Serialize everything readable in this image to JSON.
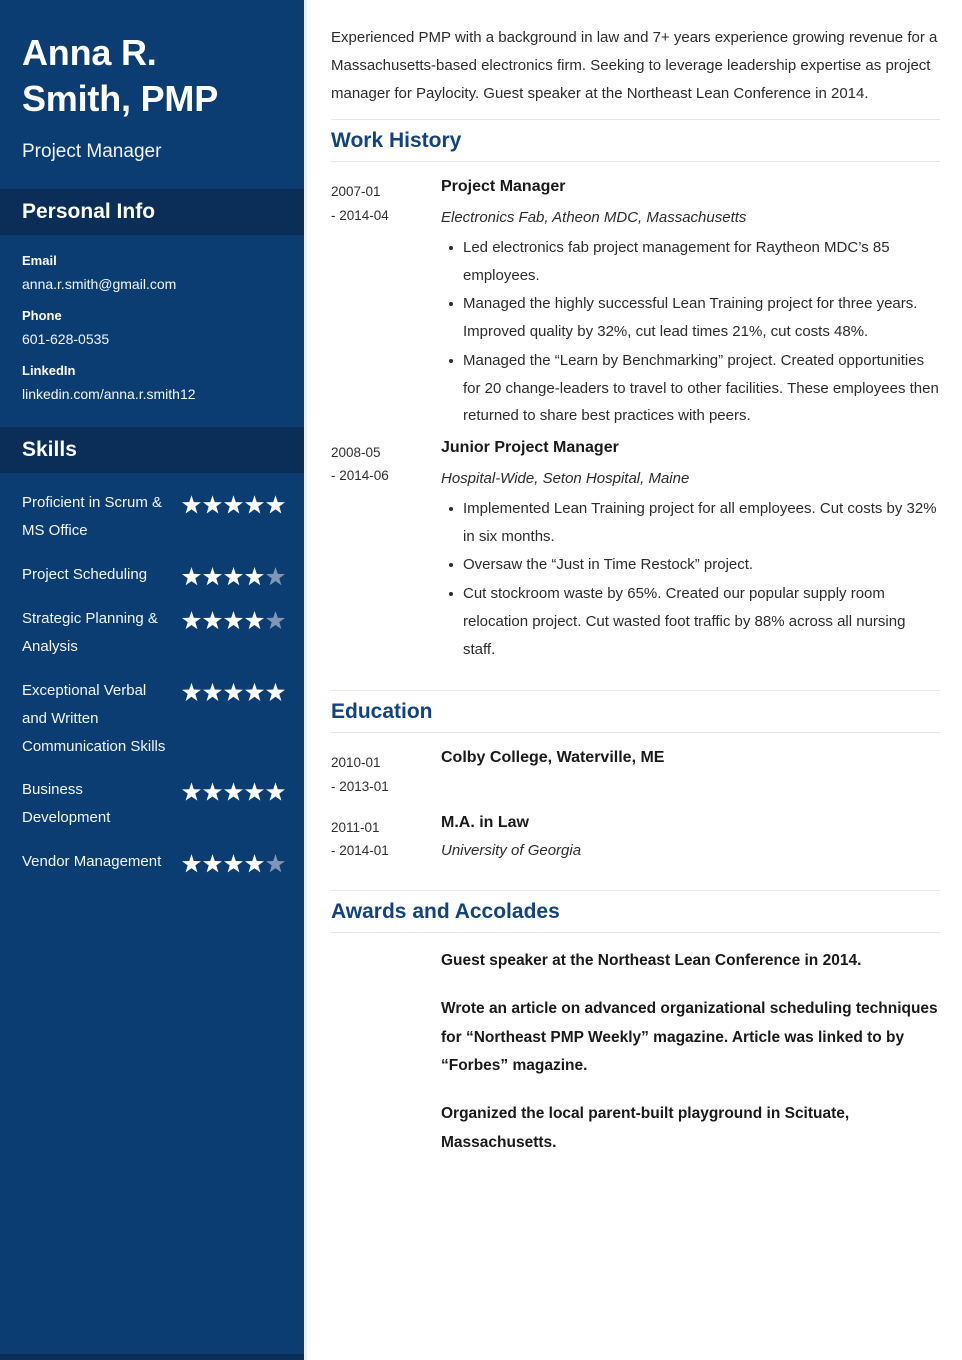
{
  "sidebar": {
    "name": "Anna R. Smith, PMP",
    "name_line1": "Anna R.",
    "name_line2": "Smith, PMP",
    "job_title": "Project Manager",
    "personal_info": {
      "heading": "Personal Info",
      "items": [
        {
          "label": "Email",
          "value": "anna.r.smith@gmail.com"
        },
        {
          "label": "Phone",
          "value": "601-628-0535"
        },
        {
          "label": "LinkedIn",
          "value": "linkedin.com/anna.r.smith12"
        }
      ]
    },
    "skills": {
      "heading": "Skills",
      "max_rating": 5,
      "items": [
        {
          "name": "Proficient in Scrum & MS Office",
          "rating": 5
        },
        {
          "name": "Project Scheduling",
          "rating": 4
        },
        {
          "name": "Strategic Planning & Analysis",
          "rating": 4
        },
        {
          "name": "Exceptional Verbal and Written Communication Skills",
          "rating": 5
        },
        {
          "name": "Business Development",
          "rating": 5
        },
        {
          "name": "Vendor Management",
          "rating": 4
        }
      ]
    }
  },
  "main": {
    "summary": "Experienced PMP with a background in law and 7+ years experience growing revenue for a Massachusetts-based electronics firm. Seeking to leverage leadership expertise as project manager for Paylocity. Guest speaker at the Northeast Lean Conference in 2014.",
    "work_history": {
      "heading": "Work History",
      "entries": [
        {
          "date_start": "2007-01",
          "date_end": "- 2014-04",
          "role": "Project Manager",
          "org": "Electronics Fab, Atheon MDC, Massachusetts",
          "bullets": [
            "Led electronics fab project management for Raytheon MDC’s 85 employees.",
            "Managed the highly successful Lean Training project for three years. Improved quality by 32%, cut lead times 21%, cut costs 48%.",
            "Managed the “Learn by Benchmarking” project. Created opportunities for 20 change-leaders to travel to other facilities. These employees then returned to share best practices with peers."
          ]
        },
        {
          "date_start": "2008-05",
          "date_end": "- 2014-06",
          "role": "Junior Project Manager",
          "org": "Hospital-Wide, Seton Hospital, Maine",
          "bullets": [
            "Implemented Lean Training project for all employees. Cut costs by 32% in six months.",
            "Oversaw the “Just in Time Restock” project.",
            "Cut stockroom waste by 65%. Created our popular supply room relocation project. Cut wasted foot traffic by 88% across all nursing staff."
          ]
        }
      ]
    },
    "education": {
      "heading": "Education",
      "entries": [
        {
          "date_start": "2010-01",
          "date_end": "- 2013-01",
          "school": "Colby College, Waterville, ME",
          "sub": ""
        },
        {
          "date_start": "2011-01",
          "date_end": "- 2014-01",
          "school": "M.A. in Law",
          "sub": "University of Georgia"
        }
      ]
    },
    "awards": {
      "heading": "Awards and Accolades",
      "items": [
        "Guest speaker at the Northeast Lean Conference in 2014.",
        "Wrote an article on advanced organizational scheduling techniques for “Northeast PMP Weekly” magazine. Article was linked to by “Forbes” magazine.",
        "Organized the local parent-built playground in Scituate, Massachusetts."
      ]
    }
  },
  "colors": {
    "sidebar_bg": "#0b3d72",
    "sidebar_band_bg": "#0a2e58",
    "heading_blue": "#12437f",
    "star_on": "#ffffff",
    "star_off": "#8096b4",
    "rule": "#e4e6e8",
    "body_text": "#2c2c2c"
  }
}
